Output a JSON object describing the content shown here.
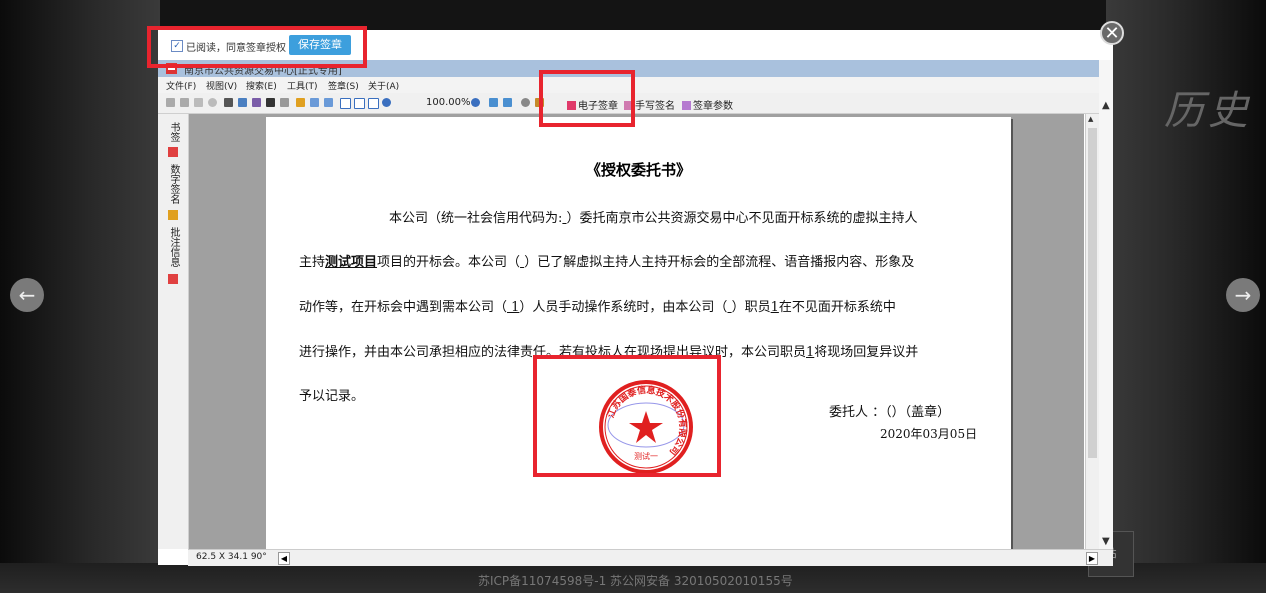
{
  "background": {
    "title_text": "历史",
    "nav_left": "←",
    "nav_right": "→",
    "footer": "苏ICP备11074598号-1 苏公网安备 32010502010155号",
    "paste_label": "贴",
    "close_symbol": "✕"
  },
  "agree_bar": {
    "checkbox_mark": "✓",
    "label": "已阅读，同意签章授权",
    "save_button": "保存签章"
  },
  "app": {
    "title": "南京市公共资源交易中心[正式专用]",
    "menu": [
      "文件(F)",
      "视图(V)",
      "搜索(E)",
      "工具(T)",
      "签章(S)",
      "关于(A)"
    ],
    "zoom": "100.00%",
    "toolbar_buttons": {
      "electronic_seal": "电子签章",
      "handwritten_sign": "手写签名",
      "seal_params": "签章参数"
    },
    "sidebar_tabs": [
      "书签",
      "数字签名",
      "批注信息"
    ],
    "status_size": "62.5 X 34.1 90°",
    "scroll_up": "▲",
    "scroll_down": "▼",
    "scroll_left": "◀",
    "scroll_right": "▶"
  },
  "document": {
    "title": "《授权委托书》",
    "line1": {
      "a": "本公司（统一社会信用代码为:",
      "b": "   ",
      "c": "）委托南京市公共资源交易中心不见面开标系统的虚拟主持人"
    },
    "line2": {
      "a": "主持",
      "b": "测试项目",
      "c": "项目的开标会。本公司（",
      "d": "   ",
      "e": "）已了解虚拟主持人主持开标会的全部流程、语音播报内容、形象及"
    },
    "line3": {
      "a": "动作等，在开标会中遇到需本公司（",
      "b": "  1",
      "c": "）人员手动操作系统时，由本公司（",
      "d": "     ",
      "e": "）职员",
      "f": "1",
      "g": "在不见面开标系统中"
    },
    "line4": {
      "a": "进行操作，并由本公司承担相应的法律责任。若有投标人在现场提出异议时，本公司职员",
      "b": "1",
      "c": "将现场回复异议并"
    },
    "line5": "予以记录。",
    "signatory": "委托人 ：（）（盖章）",
    "date": "2020年03月05日",
    "seal": {
      "ring_text": "江苏国泰信息技术股份有限公司",
      "bottom_text": "测试一",
      "color": "#e02020"
    }
  },
  "colors": {
    "highlight": "#e8242e",
    "save_button": "#3d9fdd",
    "title_bar": "#a9c1dd"
  }
}
